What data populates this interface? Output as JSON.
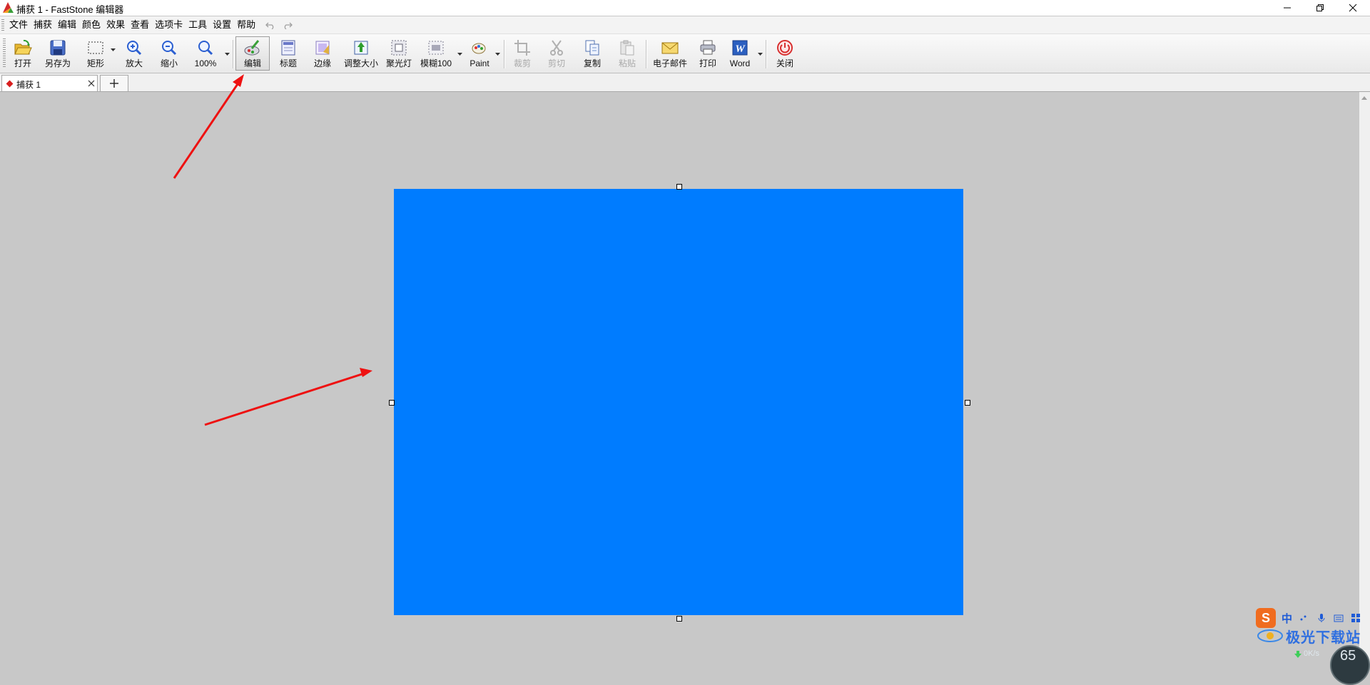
{
  "window": {
    "title": "捕获 1 - FastStone 编辑器"
  },
  "menu": [
    "文件",
    "捕获",
    "编辑",
    "颜色",
    "效果",
    "查看",
    "选项卡",
    "工具",
    "设置",
    "帮助"
  ],
  "toolbar": {
    "open": "打开",
    "save_as": "另存为",
    "rect": "矩形",
    "zoom_in": "放大",
    "zoom_out": "缩小",
    "zoom_level": "100%",
    "edit": "编辑",
    "caption": "标题",
    "edge": "边缘",
    "resize": "调整大小",
    "spotlight": "聚光灯",
    "blur": "模糊100",
    "paint": "Paint",
    "crop": "裁剪",
    "cut": "剪切",
    "copy": "复制",
    "paste": "粘贴",
    "email": "电子邮件",
    "print": "打印",
    "word": "Word",
    "close": "关闭"
  },
  "tabs": {
    "active": "捕获 1"
  },
  "image": {
    "fill_color": "#007cff"
  },
  "annotations": {
    "arrow_color": "#ee1111"
  },
  "ime": {
    "mode": "中",
    "logo": "S"
  },
  "watermark": {
    "text": "极光下载站"
  },
  "net": {
    "speed": "0K/s",
    "gauge": "65"
  }
}
